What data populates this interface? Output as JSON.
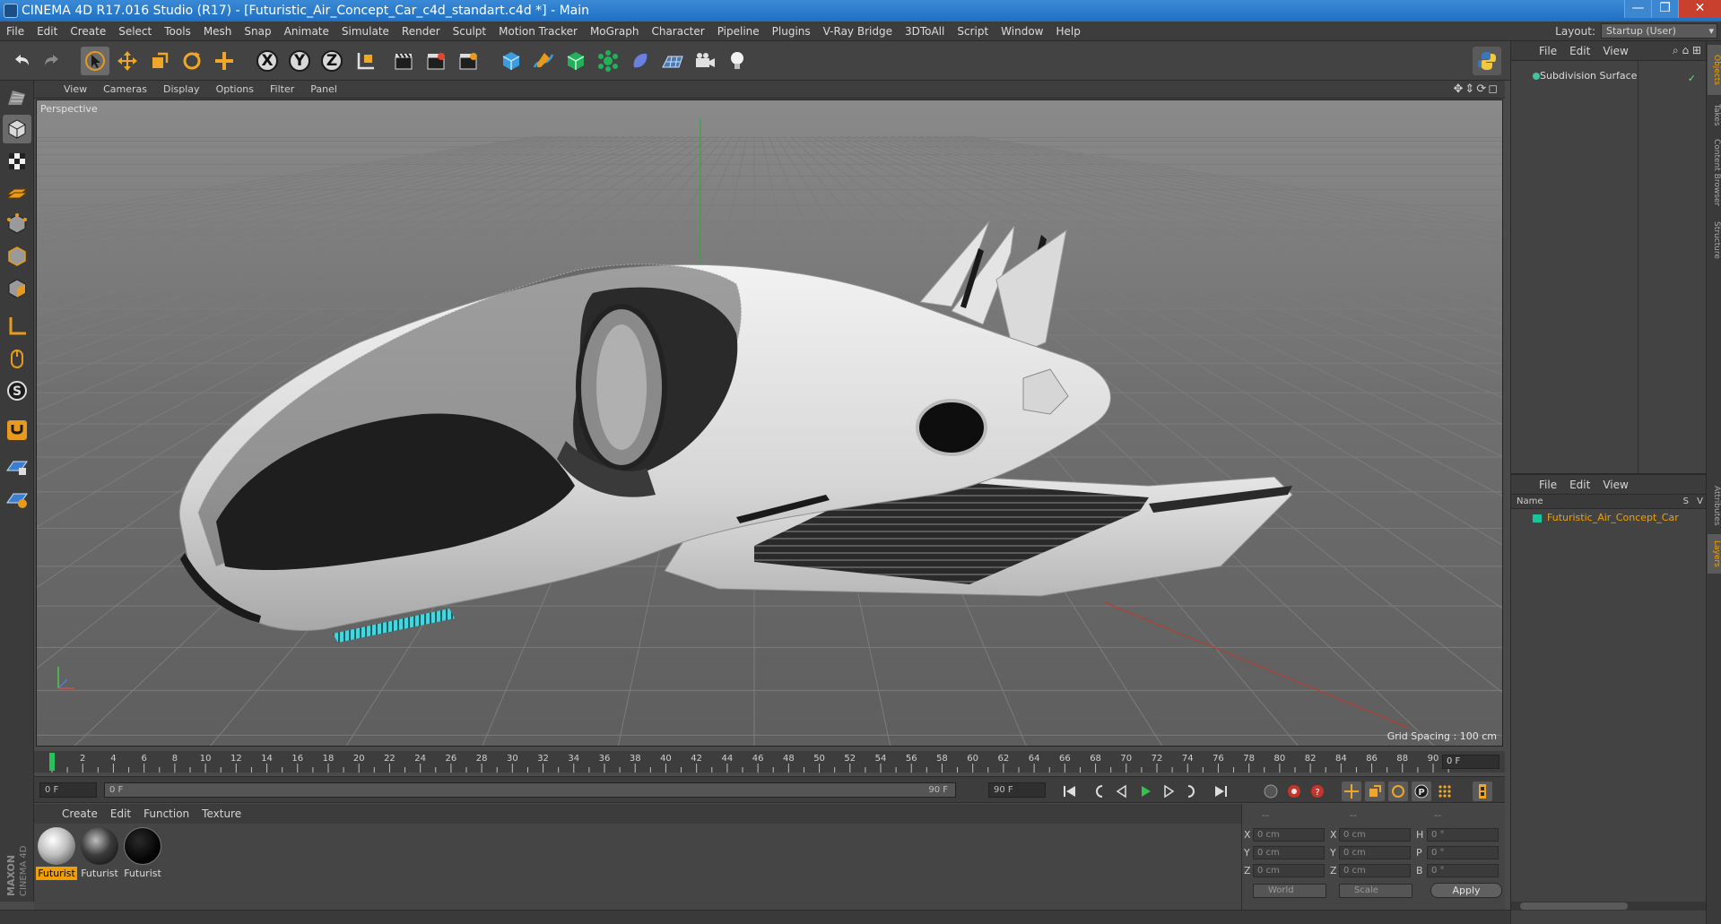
{
  "window": {
    "title": "CINEMA 4D R17.016 Studio (R17) - [Futuristic_Air_Concept_Car_c4d_standart.c4d *] - Main",
    "controls": [
      "—",
      "❐",
      "✕"
    ]
  },
  "menubar": {
    "items": [
      "File",
      "Edit",
      "Create",
      "Select",
      "Tools",
      "Mesh",
      "Snap",
      "Animate",
      "Simulate",
      "Render",
      "Sculpt",
      "Motion Tracker",
      "MoGraph",
      "Character",
      "Pipeline",
      "Plugins",
      "V-Ray Bridge",
      "3DToAll",
      "Script",
      "Window",
      "Help"
    ],
    "layout_label": "Layout:",
    "layout_value": "Startup (User)"
  },
  "toolbar": {
    "axis_x": "X",
    "axis_y": "Y",
    "axis_z": "Z"
  },
  "viewport": {
    "menu": [
      "View",
      "Cameras",
      "Display",
      "Options",
      "Filter",
      "Panel"
    ],
    "label": "Perspective",
    "grid_spacing": "Grid Spacing : 100 cm",
    "nav_icons": "✥⇕⟳◻"
  },
  "timeline": {
    "ticks": [
      "0",
      "2",
      "4",
      "6",
      "8",
      "10",
      "12",
      "14",
      "16",
      "18",
      "20",
      "22",
      "24",
      "26",
      "28",
      "30",
      "32",
      "34",
      "36",
      "38",
      "40",
      "42",
      "44",
      "46",
      "48",
      "50",
      "52",
      "54",
      "56",
      "58",
      "60",
      "62",
      "64",
      "66",
      "68",
      "70",
      "72",
      "74",
      "76",
      "78",
      "80",
      "82",
      "84",
      "86",
      "88",
      "90"
    ],
    "current_frame": "0 F",
    "playhead_position": 0
  },
  "playbar": {
    "start_field": "0 F",
    "range_start": "0 F",
    "range_end": "90 F",
    "end_field": "90 F"
  },
  "materials": {
    "menu": [
      "Create",
      "Edit",
      "Function",
      "Texture"
    ],
    "items": [
      {
        "name": "Futurist",
        "selected": true
      },
      {
        "name": "Futurist",
        "selected": false
      },
      {
        "name": "Futurist",
        "selected": false
      }
    ]
  },
  "coordinates": {
    "headers": [
      "--",
      "--",
      "--"
    ],
    "rows": [
      {
        "l1": "X",
        "v1": "0 cm",
        "l2": "X",
        "v2": "0 cm",
        "l3": "H",
        "v3": "0 °"
      },
      {
        "l1": "Y",
        "v1": "0 cm",
        "l2": "Y",
        "v2": "0 cm",
        "l3": "P",
        "v3": "0 °"
      },
      {
        "l1": "Z",
        "v1": "0 cm",
        "l2": "Z",
        "v2": "0 cm",
        "l3": "B",
        "v3": "0 °"
      }
    ],
    "mode_world": "World",
    "mode_scale": "Scale",
    "apply": "Apply"
  },
  "objects_panel": {
    "menu": [
      "File",
      "Edit",
      "View"
    ],
    "object_name": "Subdivision Surface",
    "tags": "✓"
  },
  "layers_panel": {
    "menu": [
      "File",
      "Edit",
      "View"
    ],
    "col_name": "Name",
    "col_s": "S",
    "col_v": "V",
    "layer_name": "Futuristic_Air_Concept_Car"
  },
  "side_tabs": {
    "top": [
      "Objects",
      "Takes",
      "Content Browser",
      "Structure"
    ],
    "bottom": [
      "Attributes",
      "Layers"
    ]
  },
  "brand": {
    "maxon": "MAXON",
    "product": "CINEMA 4D"
  },
  "colors": {
    "accent": "#f0a000",
    "title_blue": "#2a7fd4",
    "layer_color": "#19c49a",
    "viewport_bg": "#6a6a6a"
  }
}
